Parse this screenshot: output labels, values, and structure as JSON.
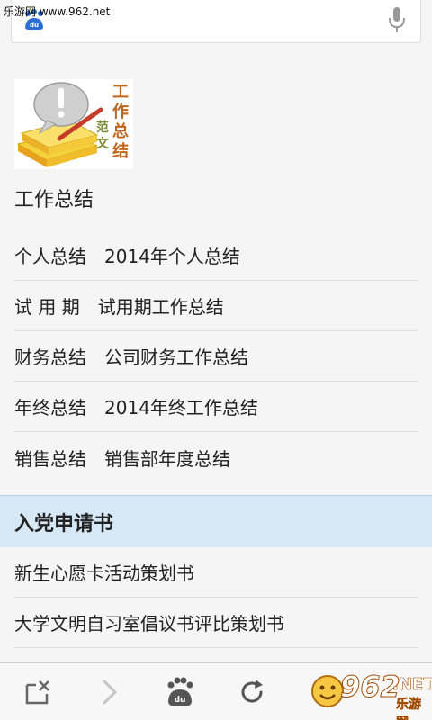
{
  "watermark_top": "乐游网 www.962.net",
  "search": {
    "logo_icon": "baidu-paw-icon",
    "mic_icon": "microphone-icon"
  },
  "banner": {
    "vertical_text_1": "工作总结",
    "vertical_text_2": "范文"
  },
  "section1": {
    "title": "工作总结",
    "rows": [
      {
        "category": "个人总结",
        "item": "2014年个人总结"
      },
      {
        "category": "试 用 期",
        "item": "试用期工作总结"
      },
      {
        "category": "财务总结",
        "item": "公司财务工作总结"
      },
      {
        "category": "年终总结",
        "item": "2014年终工作总结"
      },
      {
        "category": "销售总结",
        "item": "销售部年度总结"
      }
    ]
  },
  "section2": {
    "title": "入党申请书",
    "rows": [
      {
        "item": "新生心愿卡活动策划书"
      },
      {
        "item": "大学文明自习室倡议书评比策划书"
      }
    ]
  },
  "bottom_nav": {
    "icons": [
      "close-tab-icon",
      "forward-icon",
      "baidu-paw-icon",
      "refresh-icon"
    ]
  },
  "watermark_bottom": {
    "number": "962",
    "net": ".NET",
    "site": "乐游网"
  },
  "colors": {
    "section_header_bg": "#d6e7f5",
    "row_divider": "#dedede",
    "accent_blue": "#3c8ddc"
  }
}
